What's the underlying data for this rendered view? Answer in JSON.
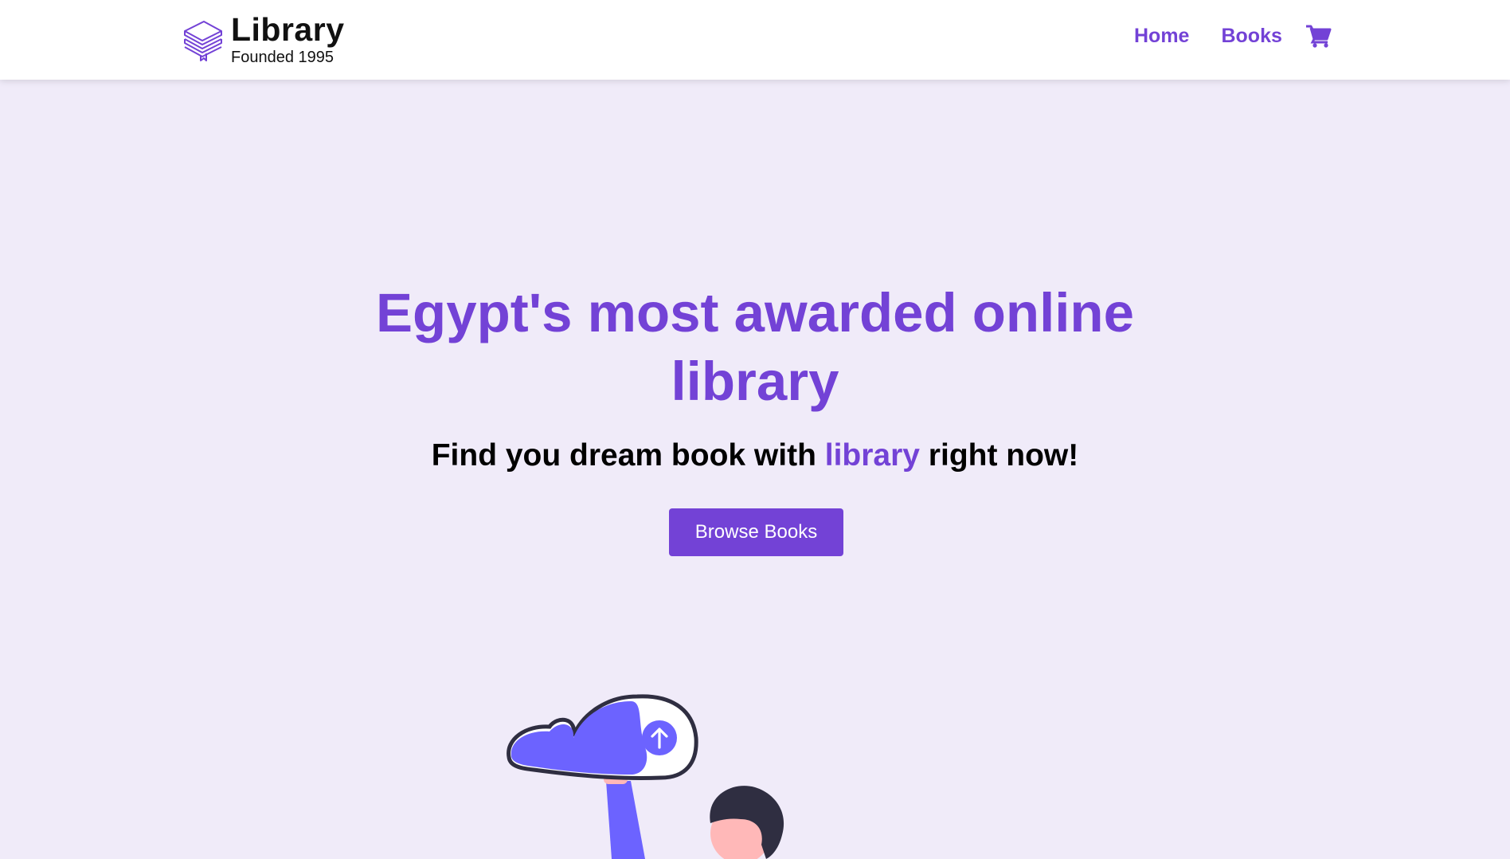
{
  "brand": {
    "title": "Library",
    "subtitle": "Founded 1995",
    "logo_icon": "stacked-books-icon"
  },
  "nav": {
    "links": [
      {
        "label": "Home"
      },
      {
        "label": "Books"
      }
    ],
    "cart_icon": "shopping-cart-icon"
  },
  "hero": {
    "title_line1": "Egypt's most awarded online",
    "title_line2": "library",
    "subtitle_before": "Find you dream book with ",
    "subtitle_accent": "library",
    "subtitle_after": " right now!",
    "button_label": "Browse Books",
    "illustration_icon": "person-uploading-cloud-illustration"
  },
  "colors": {
    "accent": "#7342d6",
    "background": "#f0ebf9",
    "illustration_purple": "#6c63ff",
    "skin": "#ffb8b8",
    "dark": "#2f2e41"
  }
}
